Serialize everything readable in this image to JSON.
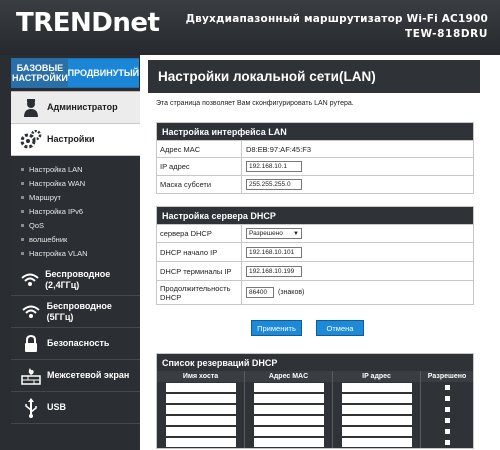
{
  "header": {
    "brand": "TRENDnet",
    "product_title": "Двухдиапазонный маршрутизатор Wi-Fi AC1900",
    "model": "TEW-818DRU"
  },
  "mode_tabs": {
    "basic": "БАЗОВЫЕ НАСТРОЙКИ",
    "advanced": "ПРОДВИНУТЫЙ"
  },
  "sidebar": {
    "admin": "Администратор",
    "settings": "Настройки",
    "submenu": [
      "Настройка LAN",
      "Настройка WAN",
      "Маршрут",
      "Настройка IPv6",
      "QoS",
      "волшебник",
      "Настройка VLAN"
    ],
    "wireless24": "Беспроводное (2,4ГГц)",
    "wireless5": "Беспроводное (5ГГц)",
    "security": "Безопасность",
    "firewall": "Межсетевой экран",
    "usb": "USB"
  },
  "main": {
    "title": "Настройки локальной сети(LAN)",
    "description": "Эта страница позволяет Вам сконфигурировать LAN рутера.",
    "lan_section": {
      "title": "Настройка интерфейса LAN",
      "mac_label": "Адрес MAC",
      "mac_value": "D8:EB:97:AF:45:F3",
      "ip_label": "IP адрес",
      "ip_value": "192.168.10.1",
      "mask_label": "Маска субсети",
      "mask_value": "255.255.255.0"
    },
    "dhcp_section": {
      "title": "Настройка сервера DHCP",
      "server_label": "сервера DHCP",
      "server_value": "Разрешено",
      "start_label": "DHCP начало IP",
      "start_value": "192.168.10.101",
      "end_label": "DHCP терминалы IP",
      "end_value": "192.168.10.199",
      "lease_label": "Продолжительность DHCP",
      "lease_value": "86400",
      "lease_unit": "(знаков)"
    },
    "apply_label": "Применить",
    "cancel_label": "Отмена",
    "reservation": {
      "title": "Список резерваций DHCP",
      "columns": [
        "Имя хоста",
        "Адрес MAC",
        "IP адрес",
        "Разрешено"
      ]
    }
  },
  "colors": {
    "accent": "#1b86d6",
    "header_bg": "#2f3237"
  }
}
